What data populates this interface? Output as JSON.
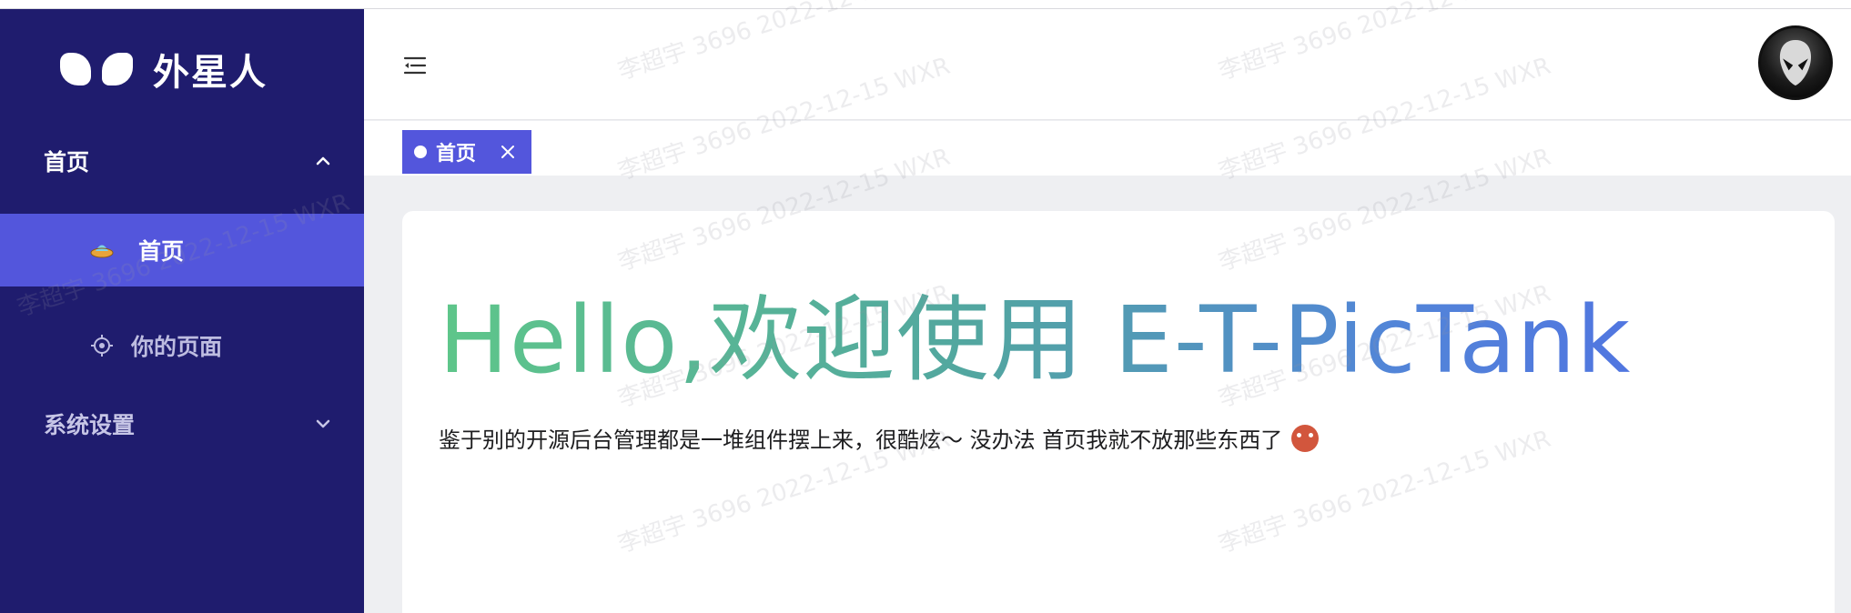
{
  "brand": {
    "logo_text": "外星人"
  },
  "sidebar": {
    "groups": [
      {
        "label": "首页",
        "expanded": true,
        "items": [
          {
            "label": "首页",
            "icon": "ufo-icon",
            "active": true
          },
          {
            "label": "你的页面",
            "icon": "target-icon",
            "active": false
          }
        ]
      },
      {
        "label": "系统设置",
        "expanded": false,
        "items": []
      }
    ]
  },
  "header": {
    "fold_icon": "menu-fold-icon",
    "avatar": "alien-avatar"
  },
  "tabs": [
    {
      "label": "首页",
      "closable": true
    }
  ],
  "content": {
    "headline": "Hello,欢迎使用 E-T-PicTank",
    "description": "鉴于别的开源后台管理都是一堆组件摆上来，很酷炫～ 没办法 首页我就不放那些东西了",
    "emoji": "devil-face-emoji"
  },
  "watermark": {
    "text": "李超宇 3696 2022-12-15 WXR"
  },
  "colors": {
    "sidebar_bg": "#1f1c6e",
    "accent": "#5356dc",
    "gradient_start": "#5ec68a",
    "gradient_end": "#5176e0"
  }
}
